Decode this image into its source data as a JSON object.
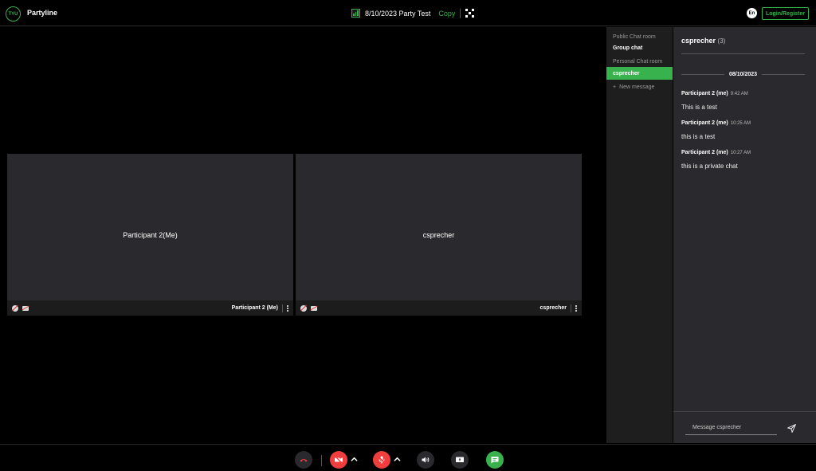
{
  "header": {
    "logo_text": "TYU",
    "app_title": "Partyline",
    "meeting_title": "8/10/2023 Party Test",
    "copy_label": "Copy",
    "language": "En",
    "login_label": "Login/Register"
  },
  "tiles": [
    {
      "center_name": "Participant 2(Me)",
      "footer_name": "Participant 2 (Me)"
    },
    {
      "center_name": "csprecher",
      "footer_name": "csprecher"
    }
  ],
  "rooms": {
    "public_heading": "Public Chat room",
    "group_chat": "Group chat",
    "personal_heading": "Personal Chat room",
    "active_room": "csprecher",
    "new_message": "New message"
  },
  "chat": {
    "recipient": "csprecher",
    "count": "(3)",
    "date": "08/10/2023",
    "messages": [
      {
        "sender": "Participant 2 (me)",
        "time": "9:42 AM",
        "text": "This is a test"
      },
      {
        "sender": "Participant 2 (me)",
        "time": "10:25 AM",
        "text": "this is a test"
      },
      {
        "sender": "Participant 2 (me)",
        "time": "10:27 AM",
        "text": "this is a private chat"
      }
    ],
    "input_placeholder": "Message csprecher"
  },
  "colors": {
    "accent": "#37b24d",
    "danger": "#f03e3e",
    "tile_bg": "#2a2a2e"
  },
  "toolbar": {
    "icons": [
      "hang-up-icon",
      "camera-off-icon",
      "mic-off-icon",
      "speaker-icon",
      "screen-share-icon",
      "chat-icon"
    ]
  }
}
